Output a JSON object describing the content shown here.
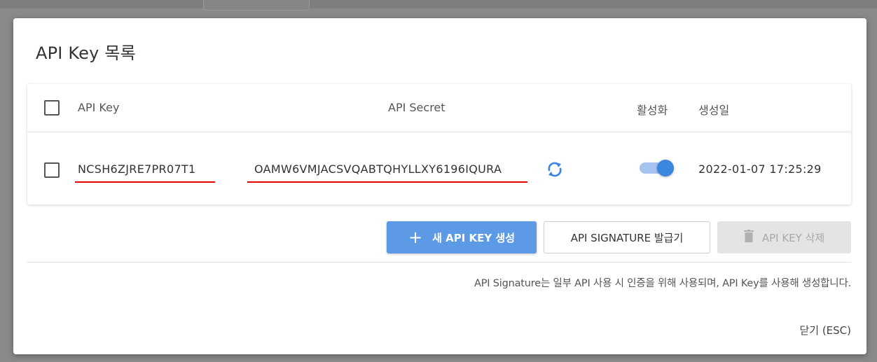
{
  "modal": {
    "title": "API Key 목록"
  },
  "table": {
    "columns": {
      "key": "API Key",
      "secret": "API Secret",
      "active": "활성화",
      "created": "생성일"
    },
    "rows": [
      {
        "key": "NCSH6ZJRE7PR07T1",
        "secret": "OAMW6VMJACSVQABTQHYLLXY6196IQURA",
        "active": true,
        "created": "2022-01-07 17:25:29"
      }
    ]
  },
  "buttons": {
    "create": "새 API KEY 생성",
    "signature": "API SIGNATURE 발급기",
    "delete": "API KEY 삭제"
  },
  "note": "API Signature는 일부 API 사용 시 인증을 위해 사용되며, API Key를 사용해 생성합니다.",
  "close": "닫기 (ESC)",
  "colors": {
    "primary": "#5c9ae6",
    "toggle_on": "#3d86e0",
    "highlight_underline": "#e60000"
  },
  "icons": [
    "plus-icon",
    "refresh-icon",
    "trash-icon"
  ]
}
